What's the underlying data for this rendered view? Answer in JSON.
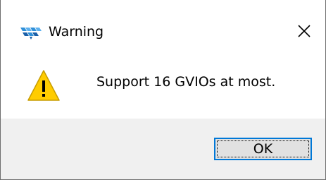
{
  "window": {
    "title": "Warning",
    "app_icon": "gowin-logo-icon",
    "close_icon": "close-icon"
  },
  "content": {
    "icon": "warning-icon",
    "message": "Support 16 GVIOs at most."
  },
  "buttons": {
    "ok_label": "OK"
  },
  "colors": {
    "app_icon_blue": "#2f8fd8",
    "app_icon_dark": "#1a5fa8",
    "warning_yellow": "#ffcc00",
    "warning_outline": "#c79c00",
    "footer_bg": "#f0f0f0",
    "button_bg": "#e1e1e1",
    "button_border": "#0078d7"
  }
}
